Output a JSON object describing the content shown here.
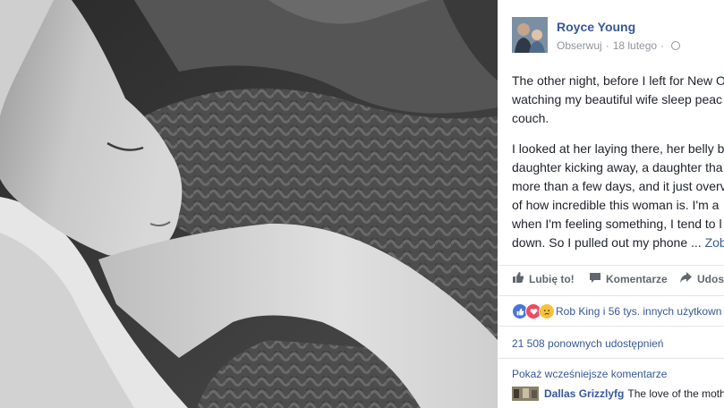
{
  "photo": {
    "description_icon": "sleeping-woman-photo"
  },
  "post": {
    "author": "Royce Young",
    "follow_label": "Obserwuj",
    "date": "18 lutego",
    "privacy_icon": "globe-icon",
    "paragraphs": [
      "The other night, before I left for New O",
      "watching my beautiful wife sleep peac",
      "couch."
    ],
    "paragraph2": [
      "I looked at her laying there, her belly b",
      "daughter kicking away, a daughter tha",
      "more than a few days, and it just overv",
      "of how incredible this woman is. I'm a",
      "when I'm feeling something, I tend to l"
    ],
    "last_line": "down. So I pulled out my phone ...",
    "see_more": "Zob"
  },
  "actions": {
    "like": "Lubię to!",
    "comment": "Komentarze",
    "share": "Udos"
  },
  "reactions": {
    "icons": [
      "like-reaction-icon",
      "love-reaction-icon",
      "sad-reaction-icon"
    ],
    "text": "Rob King i 56 tys. innych użytkown"
  },
  "shares": "21 508 ponownych udostępnień",
  "previous_comments": "Pokaż wcześniejsze komentarze",
  "comment": {
    "author": "Dallas Grizzlyfg",
    "text": "The love of the moth"
  },
  "colors": {
    "link": "#365899",
    "text": "#1d2129",
    "muted": "#90949c"
  }
}
